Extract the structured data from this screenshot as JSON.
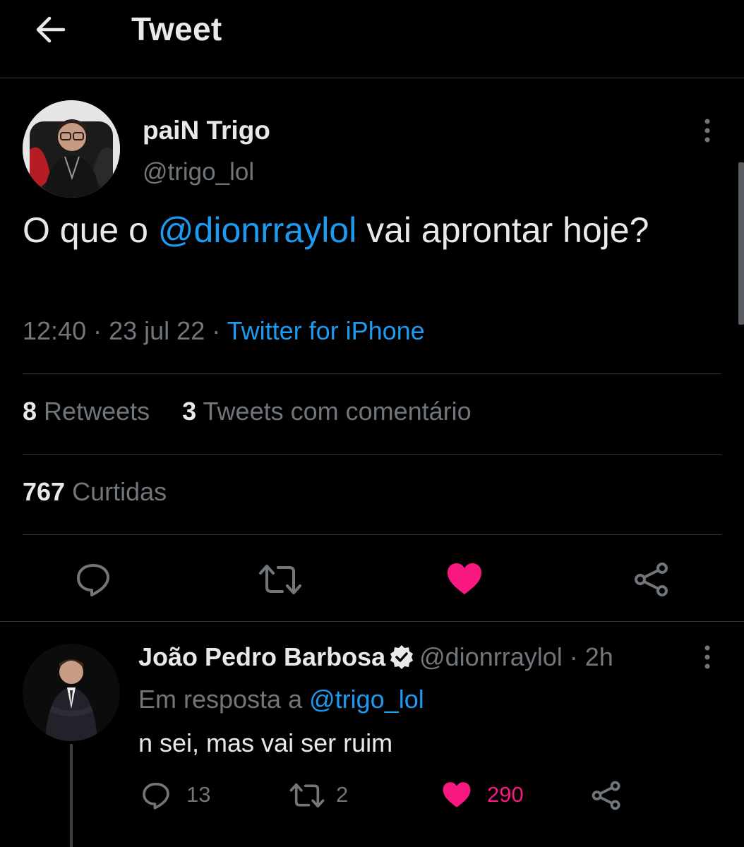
{
  "header": {
    "title": "Tweet"
  },
  "tweet": {
    "author_name": "paiN Trigo",
    "author_handle": "@trigo_lol",
    "text_before": "O que o ",
    "mention": "@dionrraylol",
    "text_after": " vai aprontar hoje?",
    "time": "12:40",
    "date": "23 jul 22",
    "source": "Twitter for iPhone",
    "retweets_count": "8",
    "retweets_label": "Retweets",
    "quotes_count": "3",
    "quotes_label": "Tweets com comentário",
    "likes_count": "767",
    "likes_label": "Curtidas",
    "liked": true
  },
  "reply": {
    "author_name": "João Pedro Barbosa",
    "author_handle": "@dionrraylol",
    "age": "2h",
    "reply_to_label": "Em resposta a",
    "reply_to_handle": "@trigo_lol",
    "text": "n sei, mas vai ser ruim",
    "reply_count": "13",
    "retweet_count": "2",
    "like_count": "290"
  },
  "colors": {
    "background": "#000000",
    "text": "#e7e9ea",
    "secondary": "#71767b",
    "accent": "#1d9bf0",
    "like": "#f91880",
    "divider": "#2f3336"
  },
  "icons": [
    "back-arrow-icon",
    "more-icon",
    "reply-icon",
    "retweet-icon",
    "heart-icon",
    "share-icon",
    "verified-icon"
  ]
}
